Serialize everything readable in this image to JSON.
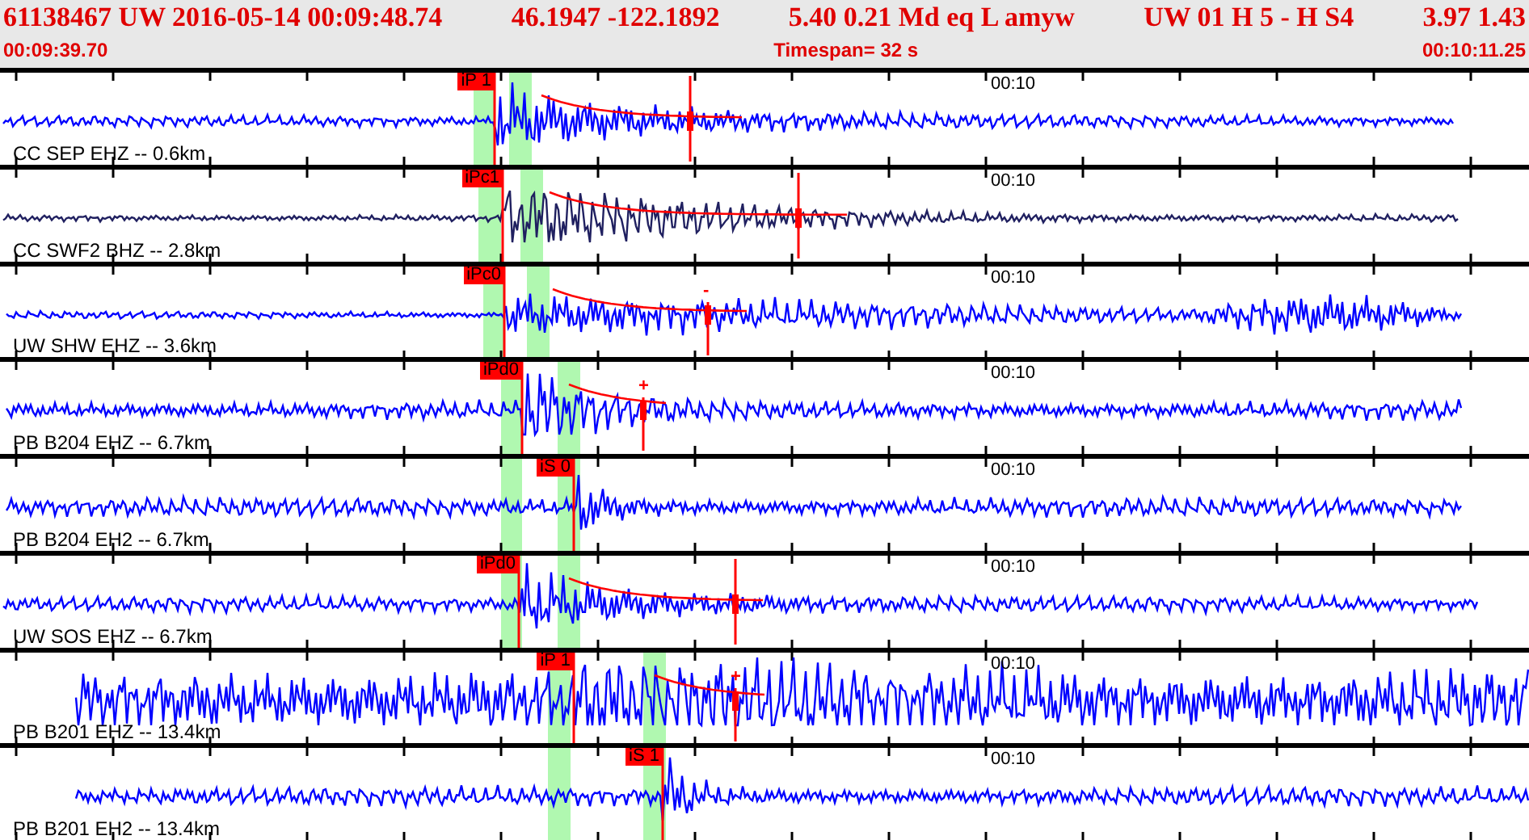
{
  "header": {
    "event_fields": [
      "61138467 UW 2016-05-14 00:09:48.74",
      "46.1947 -122.1892",
      "5.40  0.21 Md  eq  L amyw",
      "UW 01  H  5  -  H S4",
      "3.97  1.43"
    ],
    "start_time": "00:09:39.70",
    "timespan": "Timespan=  32 s",
    "end_time": "00:10:11.25"
  },
  "traces": [
    {
      "station": "CC SEP EHZ -- 0.6km",
      "pick": "iP 1",
      "time_mark": "00:10"
    },
    {
      "station": "CC SWF2 BHZ -- 2.8km",
      "pick": "iPc1",
      "time_mark": "00:10"
    },
    {
      "station": "UW SHW EHZ -- 3.6km",
      "pick": "iPc0",
      "time_mark": "00:10",
      "polarity": "-"
    },
    {
      "station": "PB B204 EHZ -- 6.7km",
      "pick": "iPd0",
      "time_mark": "00:10",
      "polarity": "+"
    },
    {
      "station": "PB B204 EH2 -- 6.7km",
      "pick": "iS 0",
      "time_mark": "00:10"
    },
    {
      "station": "UW SOS EHZ -- 6.7km",
      "pick": "iPd0",
      "time_mark": "00:10"
    },
    {
      "station": "PB B201 EHZ -- 13.4km",
      "pick": "iP 1",
      "time_mark": "00:10",
      "polarity": "+"
    },
    {
      "station": "PB B201 EH2 -- 13.4km",
      "pick": "iS 1",
      "time_mark": "00:10"
    }
  ]
}
